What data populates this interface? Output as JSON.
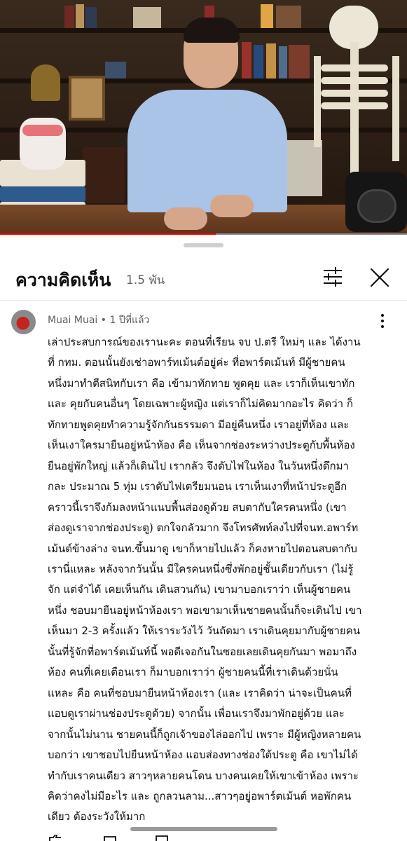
{
  "video": {
    "progress_fraction": 0.53,
    "accent_color": "#ff0000"
  },
  "comments_panel": {
    "title": "ความคิดเห็น",
    "count": "1.5 พัน",
    "filter_icon": "sliders-icon",
    "close_icon": "close-icon"
  },
  "comment": {
    "author": "Muai Muai",
    "separator": "•",
    "time": "1 ปีที่แล้ว",
    "more_icon": "more-vertical-icon",
    "text": "เล่าประสบการณ์ของเรานะคะ ตอนที่เรียน จบ ป.ตรี ใหม่ๆ และ ได้งาน\nที่ กทม. ตอนนั้นยังเช่าอพาร์ทเม้นต์อยู่ค่ะ ที่อพาร์ตเม้นท์ มีผู้ชายคน\nหนึ่งมาทำตีสนิทกับเรา คือ เข้ามาทักทาย พูดคุย และ เราก็เห็นเขาทัก\nและ คุยกับคนอื่นๆ โดยเฉพาะผู้หญิง แต่เราก็ไม่คิดมากอะไร คิดว่า ก็\nทักทายพูดคุยทำความรู้จักกันธรรมดา มีอยู่คืนหนึ่ง เราอยู่ที่ห้อง และ\nเห็นเงาใครมายืนอยู่หน้าห้อง คือ เห็นจากช่องระหว่างประตูกับพื้นห้อง\nยืนอยู่พักใหญ่ แล้วก็เดินไป เรากลัว จึงดับไฟในห้อง ในวันหนึ่งดึกมา\nกละ ประมาณ 5 ทุ่ม เราดับไฟเตรียมนอน เราเห็นเงาที่หน้าประตูอีก\nคราวนี้เราจึงก้มลงหน้าแนบพื้นส่องดูด้วย สบตากับใครคนหนึ่ง (เขา\nส่องดูเราจากช่องประตู) ตกใจกลัวมาก จึงโทรศัพท์ลงไปที่จนท.อพาร์ท\nเม้นต์ข้างล่าง จนท.ขึ้นมาดู เขาก็หายไปแล้ว ก็คงหายไปตอนสบตากับ\nเรานี่แหละ หลังจากวันนั้น มีใครคนหนึ่งซึ่งพักอยู่ชั้นเดียวกับเรา (ไม่รู้\nจัก แต่จำได้ เคยเห็นกัน เดินสวนกัน) เขามาบอกเราว่า เห็นผู้ชายคน\nหนึ่ง ชอบมายืนอยู่หน้าห้องเรา พอเขามาเห็นชายคนนั้นก็จะเดินไป เขา\nเห็นมา 2-3 ครั้งแล้ว ให้เราระวังไว้ วันถัดมา เราเดินคุยมากับผู้ชายคน\nนั้นที่รู้จักที่อพาร์ตเม้นท์นี้ พอดีเจอกันในซอยเลยเดินคุยกันมา พอมาถึง\nห้อง คนที่เคยเตือนเรา ก็มาบอกเราว่า ผู้ชายคนนี้ที่เราเดินด้วยนั่น\nแหละ คือ คนที่ชอบมายืนหน้าห้องเรา (และ เราคิดว่า น่าจะเป็นคนที่\nแอบดูเราผ่านช่องประตูด้วย) จากนั้น เพื่อนเราจึงมาพักอยู่ด้วย และ\nจากนั้นไม่นาน ชายคนนี้ก็ถูกเจ้าของไล่ออกไป เพราะ มีผู้หญิงหลายคน\nบอกว่า เขาชอบไปยืนหน้าห้อง แอบส่องทางช่องใต้ประตู คือ เขาไม่ได้\nทำกับเราคนเดียว สาวๆหลายคนโดน บางคนเคยให้เขาเข้าห้อง เพราะ\nคิดว่าคงไม่มีอะไร และ ถูกลวนลาม...สาวๆอยู่อพาร์ตเม้นต์ หอพักคน\nเดียว ต้องระวังให้มาก"
  },
  "icons": {
    "like": "thumbs-up-icon",
    "dislike": "thumbs-down-icon",
    "reply": "reply-icon"
  }
}
